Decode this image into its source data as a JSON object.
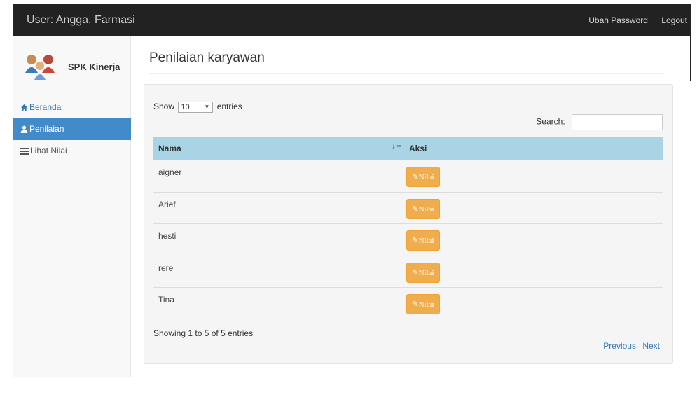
{
  "navbar": {
    "brand": "User: Angga. Farmasi",
    "links": [
      "Ubah Password",
      "Logout"
    ]
  },
  "sidebar": {
    "logo_text": "SPK Kinerja",
    "items": [
      {
        "label": "Beranda",
        "icon": "home-icon"
      },
      {
        "label": "Penilaian",
        "icon": "user-icon",
        "active": true
      },
      {
        "label": "Lihat Nilai",
        "icon": "list-icon"
      }
    ]
  },
  "page": {
    "title": "Penilaian karyawan"
  },
  "table_controls": {
    "show_label": "Show",
    "length_value": "10",
    "entries_label": "entries",
    "search_label": "Search:"
  },
  "table": {
    "columns": [
      "Nama",
      "Aksi"
    ],
    "rows": [
      {
        "nama": "aigner",
        "action": "Nilai"
      },
      {
        "nama": "Arief",
        "action": "Nilai"
      },
      {
        "nama": "hesti",
        "action": "Nilai"
      },
      {
        "nama": "rere",
        "action": "Nilai"
      },
      {
        "nama": "Tina",
        "action": "Nilai"
      }
    ],
    "info": "Showing 1 to 5 of 5 entries",
    "pager": {
      "previous": "Previous",
      "next": "Next"
    }
  },
  "colors": {
    "navbar_bg": "#222222",
    "active_menu": "#428bca",
    "table_header": "#a9d4e6",
    "button": "#f0ad4e"
  }
}
